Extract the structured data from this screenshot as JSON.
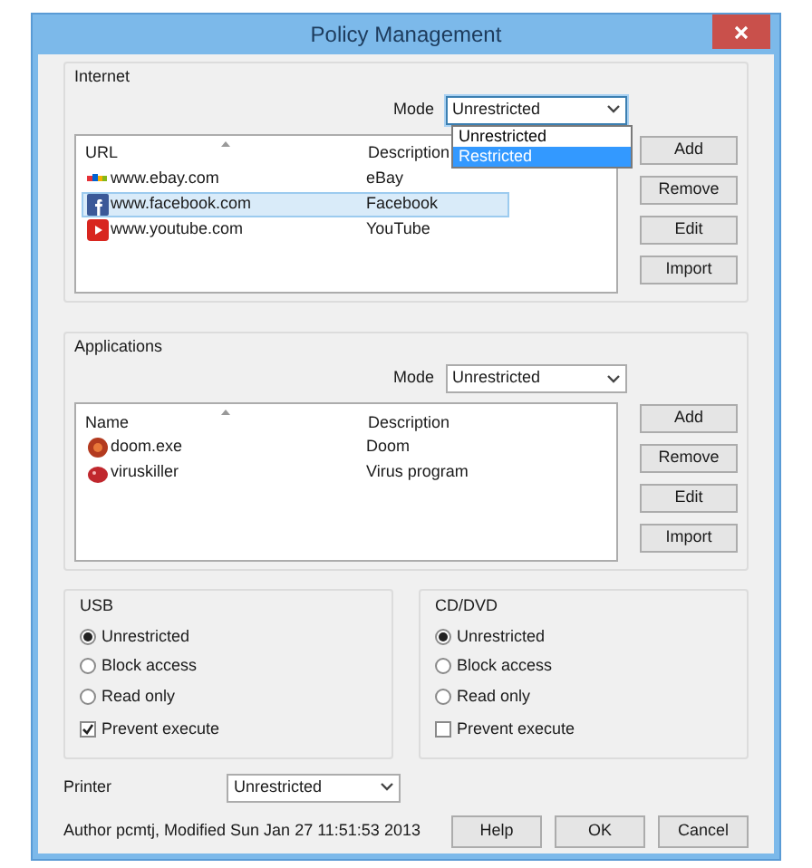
{
  "window": {
    "title": "Policy Management"
  },
  "internet": {
    "label": "Internet",
    "mode_label": "Mode",
    "mode": {
      "value": "Unrestricted",
      "expanded": true,
      "options": [
        {
          "label": "Unrestricted",
          "highlighted": false
        },
        {
          "label": "Restricted",
          "highlighted": true
        }
      ]
    },
    "columns": [
      "URL",
      "Description"
    ],
    "rows": [
      {
        "kind": "ebay",
        "name": "www.ebay.com",
        "description": "eBay",
        "selected": false
      },
      {
        "kind": "facebook",
        "name": "www.facebook.com",
        "description": "Facebook",
        "selected": true
      },
      {
        "kind": "youtube",
        "name": "www.youtube.com",
        "description": "YouTube",
        "selected": false
      }
    ],
    "buttons": [
      "Add",
      "Remove",
      "Edit",
      "Import"
    ]
  },
  "applications": {
    "label": "Applications",
    "mode_label": "Mode",
    "mode": {
      "value": "Unrestricted",
      "expanded": false
    },
    "columns": [
      "Name",
      "Description"
    ],
    "rows": [
      {
        "kind": "doom",
        "name": "doom.exe",
        "description": "Doom",
        "selected": false
      },
      {
        "kind": "virus",
        "name": "viruskiller",
        "description": "Virus program",
        "selected": false
      }
    ],
    "buttons": [
      "Add",
      "Remove",
      "Edit",
      "Import"
    ]
  },
  "usb": {
    "label": "USB",
    "options": [
      {
        "label": "Unrestricted",
        "selected": true
      },
      {
        "label": "Block access",
        "selected": false
      },
      {
        "label": "Read only",
        "selected": false
      }
    ],
    "prevent_execute": {
      "label": "Prevent execute",
      "checked": true
    }
  },
  "cd_dvd": {
    "label": "CD/DVD",
    "options": [
      {
        "label": "Unrestricted",
        "selected": true
      },
      {
        "label": "Block access",
        "selected": false
      },
      {
        "label": "Read only",
        "selected": false
      }
    ],
    "prevent_execute": {
      "label": "Prevent execute",
      "checked": false
    }
  },
  "printer": {
    "label": "Printer",
    "value": "Unrestricted"
  },
  "status": "Author pcmtj, Modified Sun Jan 27 11:51:53 2013",
  "footer_buttons": [
    "Help",
    "OK",
    "Cancel"
  ]
}
